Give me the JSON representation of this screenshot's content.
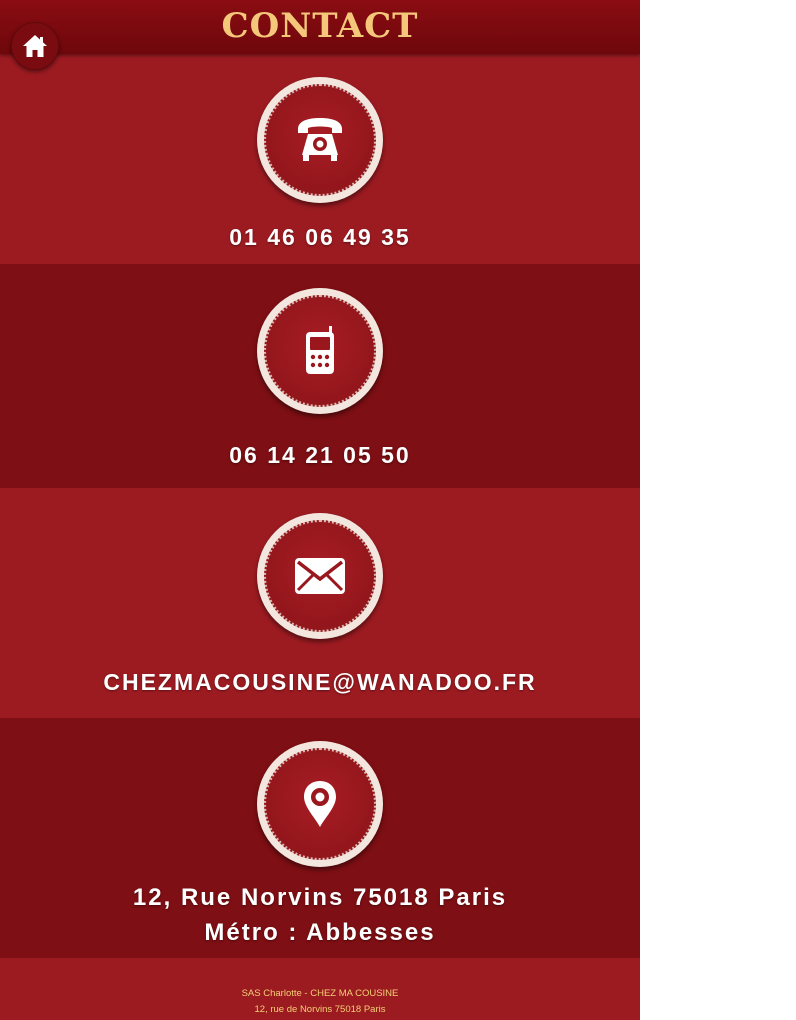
{
  "header": {
    "title": "Contact"
  },
  "contacts": {
    "phone": "01 46 06 49 35",
    "mobile": "06 14 21 05 50",
    "email": "CHEZMACOUSINE@WANADOO.FR",
    "address_line1": "12, Rue Norvins 75018 Paris",
    "address_line2": "Métro : Abbesses"
  },
  "footer": {
    "line1": "SAS Charlotte - CHEZ MA COUSINE",
    "line2": "12, rue de Norvins 75018 Paris"
  },
  "icons": [
    "home-icon",
    "telephone-icon",
    "mobile-phone-icon",
    "envelope-icon",
    "map-pin-icon"
  ],
  "colors": {
    "background": "#9b1a20",
    "header": "#7a0a0f",
    "title": "#f5c77a",
    "footer_text": "#f2cf75"
  }
}
